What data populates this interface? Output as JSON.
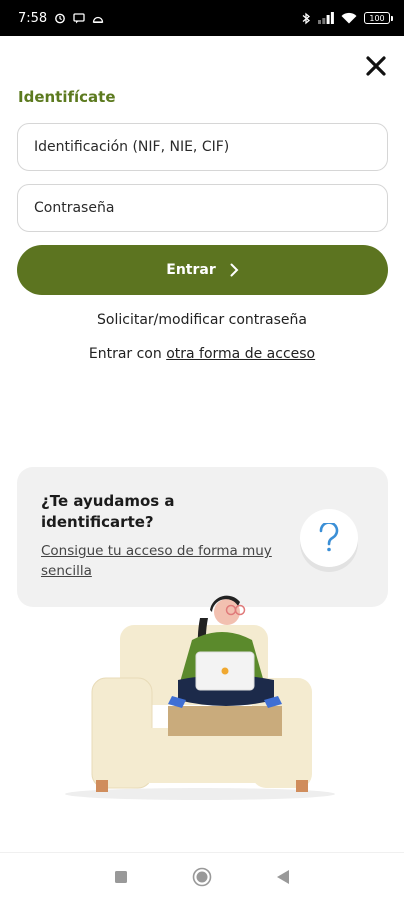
{
  "status_bar": {
    "time": "7:58",
    "battery": "100",
    "icons": [
      "alarm-icon",
      "message-icon",
      "android-icon",
      "bluetooth-icon",
      "signal-icon",
      "wifi-icon",
      "battery-icon"
    ]
  },
  "form": {
    "title": "Identifícate",
    "id_placeholder": "Identificación (NIF, NIE, CIF)",
    "password_placeholder": "Contraseña",
    "enter_label": "Entrar",
    "request_password_link": "Solicitar/modificar contraseña",
    "other_access_prefix": "Entrar con",
    "other_access_link": "otra forma de acceso"
  },
  "help_card": {
    "title": "¿Te ayudamos a identificarte?",
    "link": "Consigue tu acceso de forma muy sencilla",
    "icon": "question-icon"
  },
  "nav": {
    "icons": [
      "recents-square-icon",
      "home-circle-icon",
      "back-triangle-icon"
    ]
  },
  "colors": {
    "brand_green": "#5c7420",
    "title_green": "#5c7a1f",
    "help_blue": "#3b8fd6"
  }
}
